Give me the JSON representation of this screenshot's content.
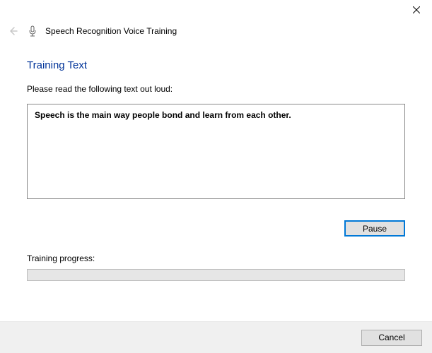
{
  "window": {
    "wizard_title": "Speech Recognition Voice Training"
  },
  "content": {
    "section_title": "Training Text",
    "instruction": "Please read the following text out loud:",
    "training_sentence": "Speech is the main way people bond and learn from each other.",
    "pause_button": "Pause",
    "progress_label": "Training progress:",
    "progress_percent": 0
  },
  "footer": {
    "cancel_button": "Cancel"
  }
}
